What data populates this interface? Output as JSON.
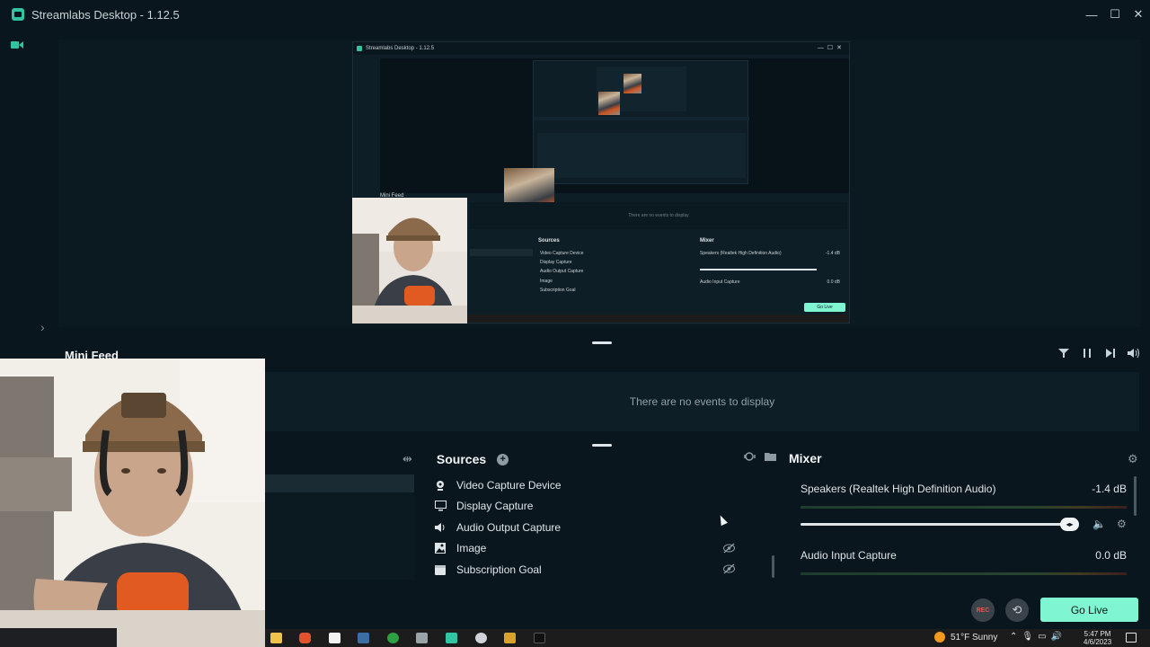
{
  "window": {
    "title": "Streamlabs Desktop - 1.12.5",
    "controls": [
      "—",
      "☐",
      "✕"
    ]
  },
  "preview_nested": {
    "title": "Streamlabs Desktop - 1.12.5",
    "feed_label": "Mini Feed",
    "feed_empty": "There are no events to display",
    "sources_title": "Sources",
    "sources": [
      "Video Capture Device",
      "Display Capture",
      "Audio Output Capture",
      "Image",
      "Subscription Goal"
    ],
    "mixer_title": "Mixer",
    "mixer_speakers": "Speakers (Realtek High Definition Audio)",
    "mixer_speakers_db": "-1.4 dB",
    "mixer_input": "Audio Input Capture",
    "mixer_input_db": "0.0 dB",
    "go_live": "Go Live"
  },
  "mini_feed": {
    "title": "Mini Feed",
    "empty_text": "There are no events to display"
  },
  "sources": {
    "title": "Sources",
    "add": "+",
    "items": [
      {
        "label": "Video Capture Device",
        "icon": "webcam-icon",
        "hidden": false
      },
      {
        "label": "Display Capture",
        "icon": "monitor-icon",
        "hidden": false
      },
      {
        "label": "Audio Output Capture",
        "icon": "speaker-icon",
        "hidden": false
      },
      {
        "label": "Image",
        "icon": "image-icon",
        "hidden": true
      },
      {
        "label": "Subscription Goal",
        "icon": "goal-icon",
        "hidden": true
      }
    ]
  },
  "mixer": {
    "title": "Mixer",
    "channels": [
      {
        "name": "Speakers (Realtek High Definition Audio)",
        "db": "-1.4 dB"
      },
      {
        "name": "Audio Input Capture",
        "db": "0.0 dB"
      }
    ]
  },
  "controls": {
    "rec": "REC",
    "go_live": "Go Live"
  },
  "taskbar": {
    "weather": "51°F  Sunny",
    "time": "5:47 PM",
    "date": "4/6/2023"
  },
  "colors": {
    "accent": "#80f5d2",
    "brand": "#31c3a2",
    "background": "#09161d"
  }
}
